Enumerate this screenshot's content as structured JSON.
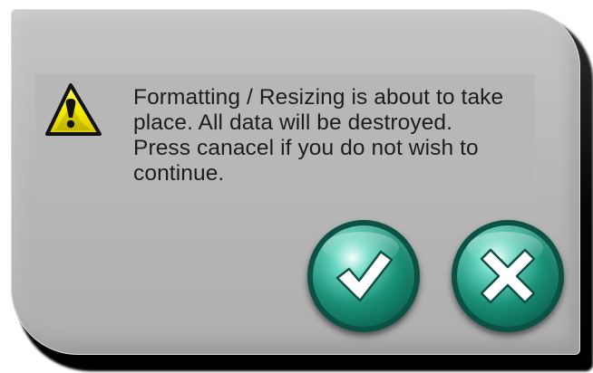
{
  "dialog": {
    "message_lines": [
      "Formatting / Resizing is about to take",
      "place. All data will be destroyed.",
      "Press canacel if you do not wish to",
      "continue."
    ],
    "icons": {
      "warning": "warning-icon",
      "confirm": "checkmark-icon",
      "cancel": "close-icon"
    },
    "colors": {
      "panel": "#b9b9b9",
      "warning_yellow": "#f7f00a",
      "button_teal": "#0f7e68"
    }
  }
}
